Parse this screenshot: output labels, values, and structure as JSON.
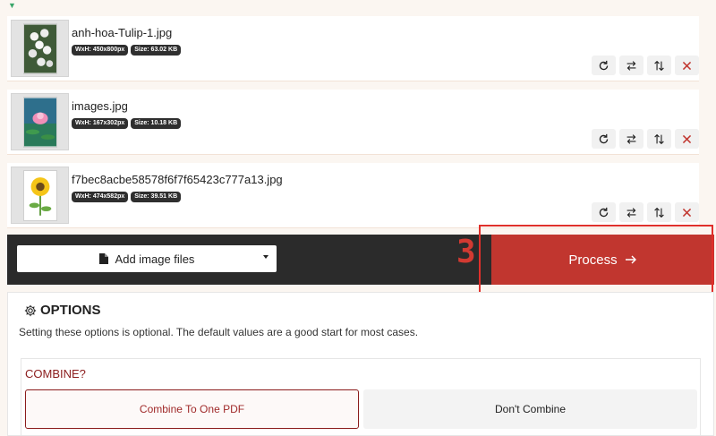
{
  "files": [
    {
      "name": "anh-hoa-Tulip-1.jpg",
      "dimensions": "WxH: 450x800px",
      "size": "Size: 63.02 KB",
      "thumbnail": "white-tulips"
    },
    {
      "name": "images.jpg",
      "dimensions": "WxH: 167x302px",
      "size": "Size: 10.18 KB",
      "thumbnail": "pink-lotus"
    },
    {
      "name": "f7bec8acbe58578f6f7f65423c777a13.jpg",
      "dimensions": "WxH: 474x582px",
      "size": "Size: 39.51 KB",
      "thumbnail": "sunflower"
    }
  ],
  "row_actions": [
    "rotate-icon",
    "swap-horizontal-icon",
    "swap-vertical-icon",
    "close-icon"
  ],
  "toolbar": {
    "add_label": "Add image files",
    "process_label": "Process",
    "step_number": "3"
  },
  "options": {
    "title": "OPTIONS",
    "description": "Setting these options is optional. The default values are a good start for most cases.",
    "combine_label": "COMBINE?",
    "combine_options": [
      "Combine To One PDF",
      "Don't Combine"
    ],
    "selected": "Combine To One PDF"
  },
  "colors": {
    "accent": "#c1362f",
    "dark_bar": "#2b2b2b",
    "highlight": "#e0302b",
    "combine_text": "#8b1c1c"
  }
}
